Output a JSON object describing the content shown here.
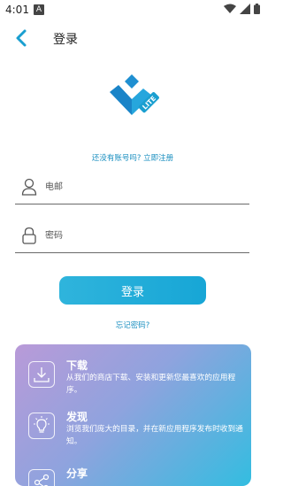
{
  "status_bar": {
    "time": "4:01",
    "notification_letter": "A"
  },
  "header": {
    "title": "登录"
  },
  "signup_prompt": "还没有账号吗? 立即注册",
  "logo_badge": "LITE",
  "form": {
    "email_placeholder": "电邮",
    "password_placeholder": "密码"
  },
  "login_button": "登录",
  "forgot_password": "忘记密码?",
  "features": [
    {
      "title": "下载",
      "description": "从我们的商店下载、安装和更新您最喜欢的应用程序。",
      "icon": "download-icon"
    },
    {
      "title": "发现",
      "description": "浏览我们庞大的目录，并在新应用程序发布时收到通知。",
      "icon": "lightbulb-icon"
    },
    {
      "title": "分享",
      "description": "",
      "icon": "share-icon"
    }
  ],
  "colors": {
    "accent": "#1a9fd0",
    "button": "#22acd9"
  }
}
